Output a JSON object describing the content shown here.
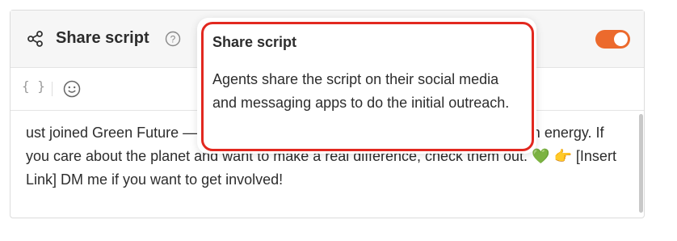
{
  "panel": {
    "title": "Share script",
    "toggle_on": true,
    "accent_color": "#ec6a2d"
  },
  "icons": {
    "header": "share-icon",
    "help": "help-circle-icon",
    "variables": "curly-braces-icon",
    "emoji": "smiley-icon"
  },
  "toolbar": {
    "variables_label": "{ }"
  },
  "editor": {
    "text_part1": "ust joined Green Future",
    "text_part2": " — they're fighting climate change and pushing for clean energy. If you care about the planet and want to make a real difference, check them out. ",
    "heart_emoji": "💚",
    "point_emoji": "👉",
    "text_part3": " [Insert Link] DM me if you want to get involved!"
  },
  "tooltip": {
    "title": "Share script",
    "body": "Agents share the script on their social media and messaging apps to do the initial outreach.",
    "highlight_color": "#e2281f"
  }
}
